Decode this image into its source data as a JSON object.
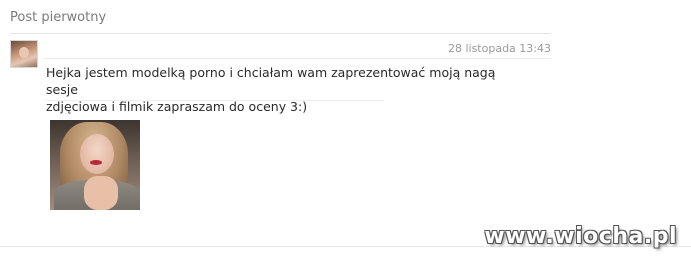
{
  "section": {
    "title": "Post pierwotny"
  },
  "post": {
    "timestamp": "28 listopada 13:43",
    "message": "Hejka jestem modelką porno i chciałam wam zaprezentować moją nagą sesje\nzdjęciowa i filmik zapraszam do oceny 3:)"
  },
  "watermark": {
    "text": "www.wiocha.pl"
  }
}
